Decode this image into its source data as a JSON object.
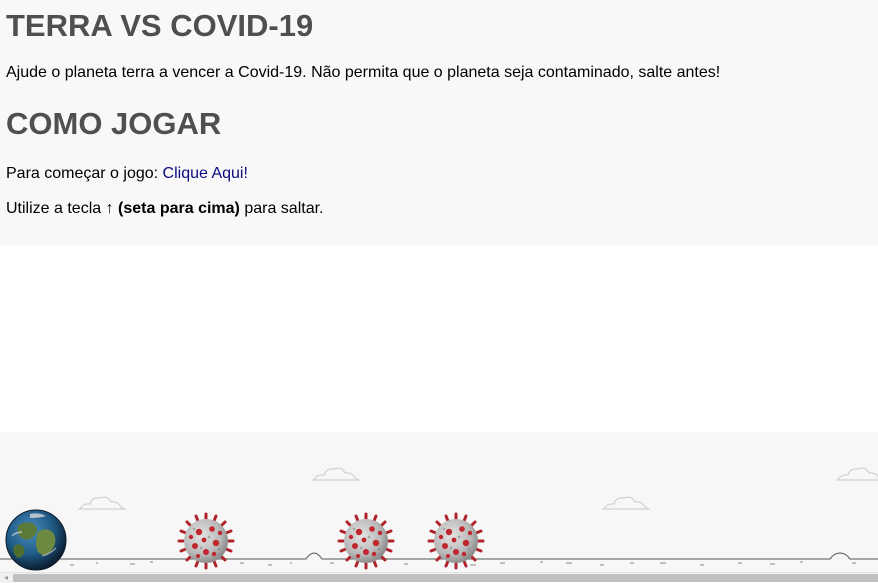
{
  "page": {
    "title": "TERRA VS COVID-19",
    "intro": "Ajude o planeta terra a vencer a Covid-19. Não permita que o planeta seja contaminado, salte antes!",
    "how_to_title": "COMO JOGAR",
    "start_prefix": "Para começar o jogo: ",
    "start_link": "Clique Aqui!",
    "help_prefix": "Utilize a tecla ",
    "help_key": "↑ (seta para cima)",
    "help_suffix": " para saltar.",
    "link_color": "#0a0a80"
  },
  "game": {
    "player": "earth-globe-icon",
    "obstacles": [
      "coronavirus-icon",
      "coronavirus-icon",
      "coronavirus-icon"
    ],
    "decor": [
      "cloud-icon",
      "cloud-icon",
      "cloud-icon",
      "cloud-icon"
    ]
  },
  "scrollbar": {
    "arrow": "◂"
  }
}
